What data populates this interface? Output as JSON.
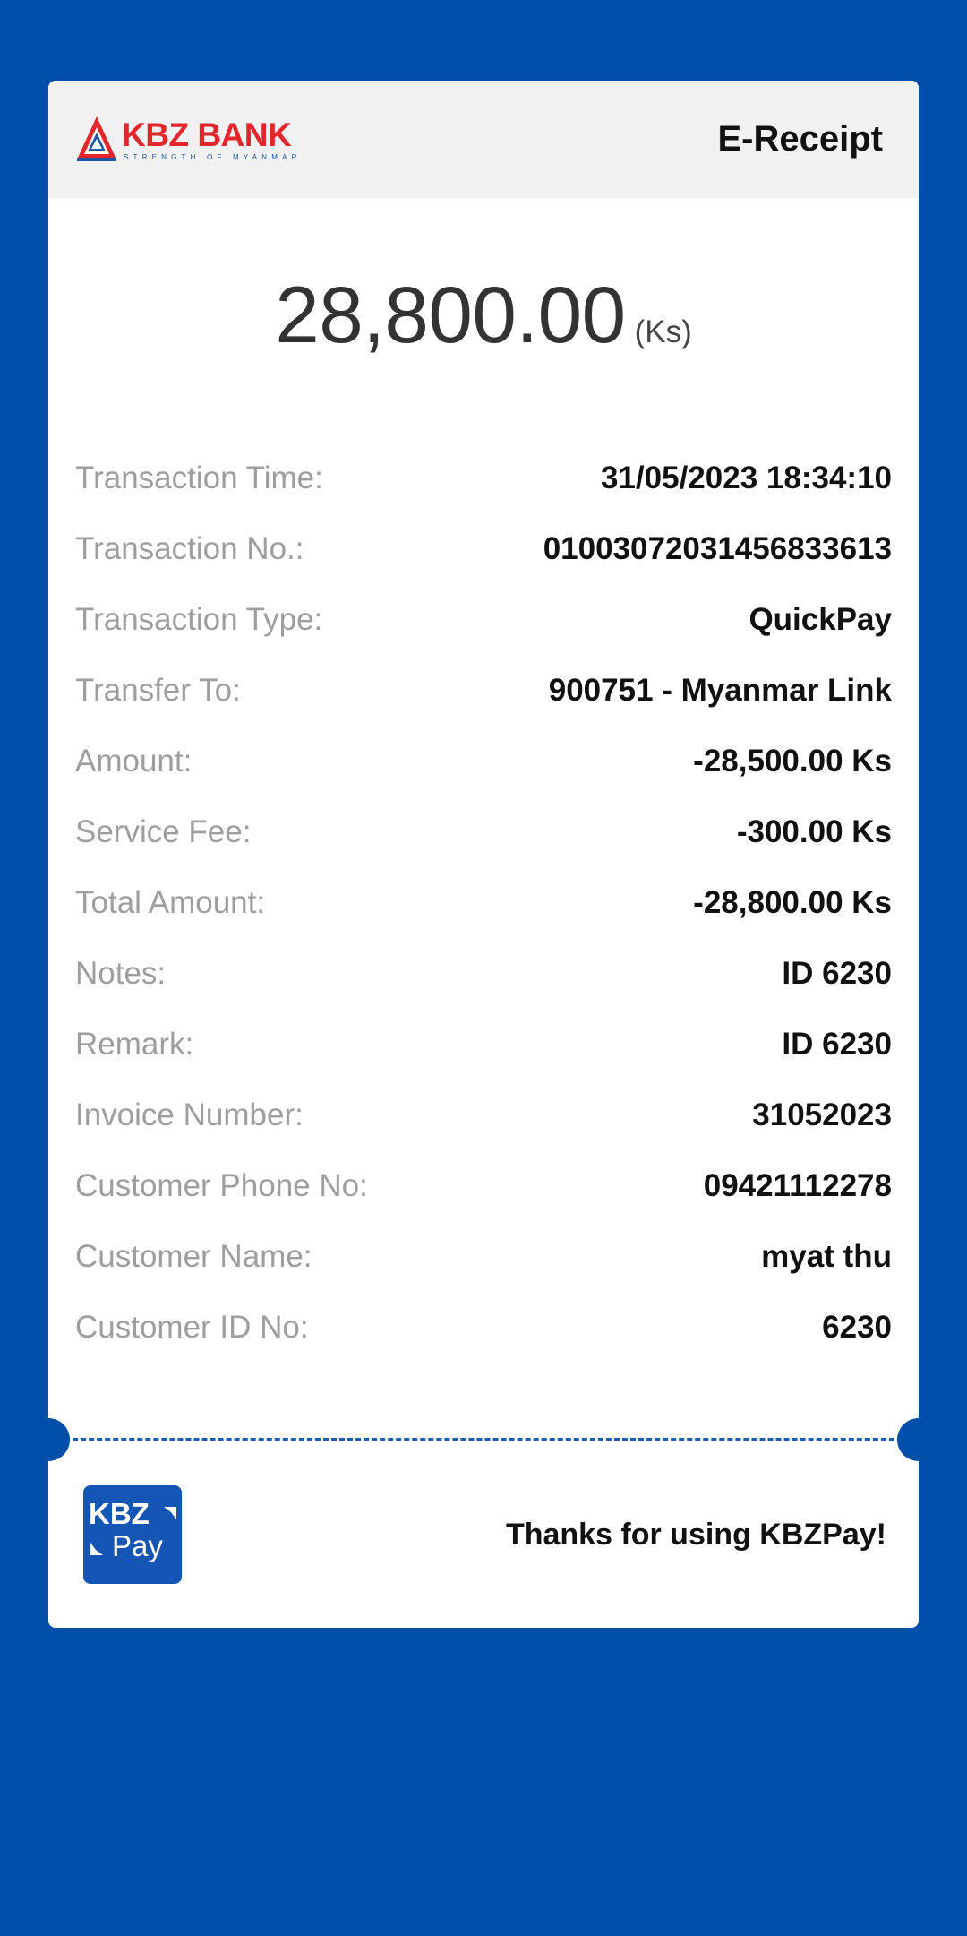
{
  "header": {
    "logo_text": "KBZ BANK",
    "logo_tagline": "STRENGTH OF MYANMAR",
    "title": "E-Receipt"
  },
  "amount": {
    "value": "28,800.00",
    "unit": "(Ks)"
  },
  "details": [
    {
      "label": "Transaction Time:",
      "value": "31/05/2023 18:34:10"
    },
    {
      "label": "Transaction No.:",
      "value": "01003072031456833613"
    },
    {
      "label": "Transaction Type:",
      "value": "QuickPay"
    },
    {
      "label": "Transfer To:",
      "value": "900751 - Myanmar Link"
    },
    {
      "label": "Amount:",
      "value": "-28,500.00 Ks"
    },
    {
      "label": "Service Fee:",
      "value": "-300.00 Ks"
    },
    {
      "label": "Total Amount:",
      "value": "-28,800.00 Ks"
    },
    {
      "label": "Notes:",
      "value": "ID 6230"
    },
    {
      "label": "Remark:",
      "value": "ID 6230"
    },
    {
      "label": "Invoice Number:",
      "value": "31052023"
    },
    {
      "label": "Customer Phone No:",
      "value": "09421112278"
    },
    {
      "label": "Customer Name:",
      "value": "myat thu"
    },
    {
      "label": "Customer ID No:",
      "value": "6230"
    }
  ],
  "footer": {
    "logo_line1": "KBZ",
    "logo_line2": "Pay",
    "thanks": "Thanks for using KBZPay!"
  },
  "colors": {
    "background": "#0050aa",
    "card": "#ffffff",
    "header_bg": "#f1f1f1",
    "brand_red": "#e3262b",
    "brand_blue": "#1e55a7",
    "label_gray": "#9e9e9e"
  },
  "icons": {
    "bank_logo": "kbz-bank-triangle-logo",
    "pay_logo": "kbzpay-app-logo"
  }
}
